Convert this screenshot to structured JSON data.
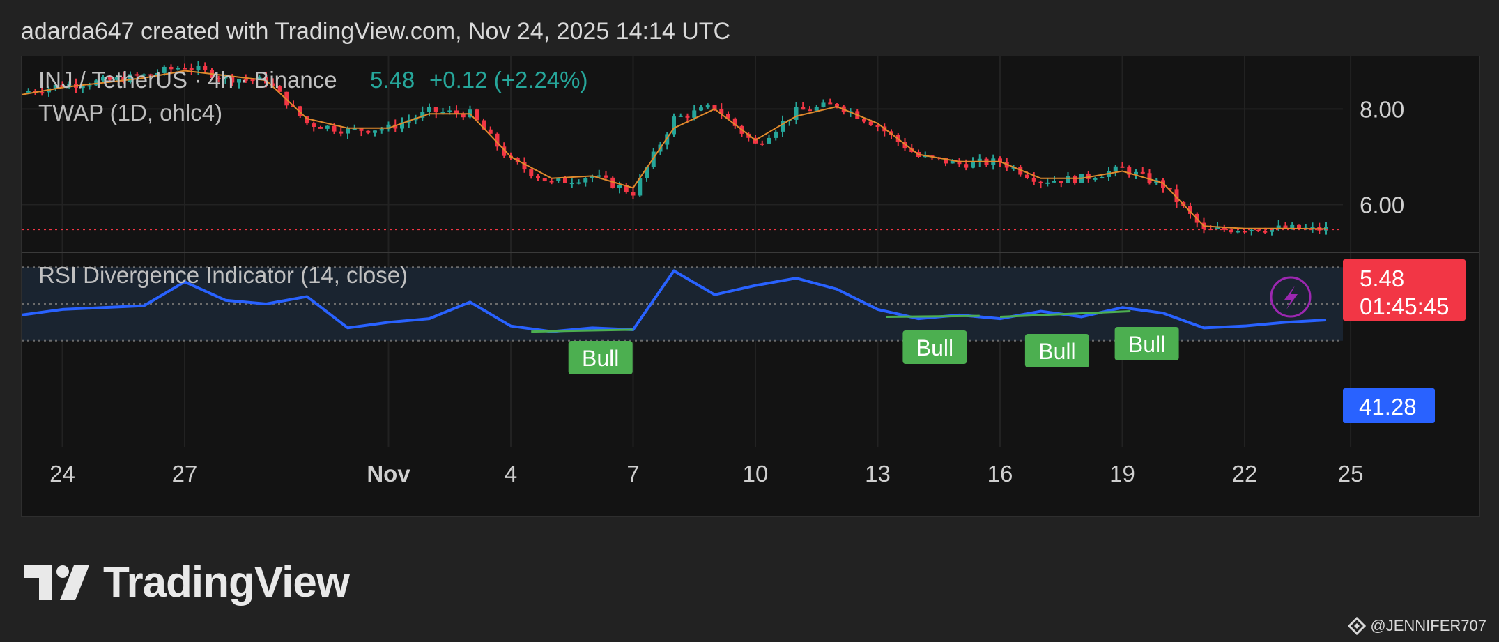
{
  "header": {
    "credit": "adarda647 created with TradingView.com, Nov 24, 2025 14:14 UTC"
  },
  "legend": {
    "symbol": "INJ / TetherUS · 4h · Binance",
    "last": "5.48",
    "change": "+0.12 (+2.24%)",
    "indicator": "TWAP (1D, ohlc4)"
  },
  "rsi_panel": {
    "title": "RSI Divergence Indicator (14, close)",
    "value_label": "41.28"
  },
  "price_scale": {
    "ticks": [
      "8.00",
      "6.00"
    ],
    "last_price": "5.48",
    "countdown": "01:45:45"
  },
  "time_axis": [
    "24",
    "27",
    "Nov",
    "4",
    "7",
    "10",
    "13",
    "16",
    "19",
    "22",
    "25"
  ],
  "bull_labels": [
    "Bull",
    "Bull",
    "Bull",
    "Bull"
  ],
  "brand": {
    "name": "TradingView"
  },
  "watermark": {
    "handle": "@JENNIFER707"
  },
  "colors": {
    "up": "#26a69a",
    "down": "#f23645",
    "twap": "#e08a2c",
    "rsi": "#2962ff",
    "bull": "#4caf50",
    "background": "#131313",
    "lightning": "#9c27b0"
  },
  "chart_data": [
    {
      "type": "line",
      "title": "INJ / TetherUS · 4h · Binance",
      "description": "candlestick price series (4h candles)",
      "x": [
        "Oct 23",
        "Oct 24",
        "Oct 25",
        "Oct 26",
        "Oct 27",
        "Oct 28",
        "Oct 29",
        "Oct 30",
        "Oct 31",
        "Nov 1",
        "Nov 2",
        "Nov 3",
        "Nov 4",
        "Nov 5",
        "Nov 6",
        "Nov 7",
        "Nov 8",
        "Nov 9",
        "Nov 10",
        "Nov 11",
        "Nov 12",
        "Nov 13",
        "Nov 14",
        "Nov 15",
        "Nov 16",
        "Nov 17",
        "Nov 18",
        "Nov 19",
        "Nov 20",
        "Nov 21",
        "Nov 22",
        "Nov 23",
        "Nov 24"
      ],
      "series": [
        {
          "name": "INJ / TetherUS",
          "values": [
            8.35,
            8.5,
            8.58,
            8.7,
            8.9,
            8.65,
            8.6,
            7.7,
            7.55,
            7.6,
            7.95,
            7.9,
            6.9,
            6.45,
            6.6,
            6.25,
            7.8,
            8.05,
            7.25,
            7.95,
            8.1,
            7.65,
            7.0,
            6.85,
            6.9,
            6.5,
            6.55,
            6.75,
            6.4,
            5.45,
            5.5,
            5.5,
            5.48
          ]
        },
        {
          "name": "TWAP (1D, ohlc4)",
          "values": [
            8.3,
            8.45,
            8.55,
            8.65,
            8.8,
            8.7,
            8.6,
            7.8,
            7.6,
            7.6,
            7.9,
            7.9,
            7.0,
            6.55,
            6.6,
            6.35,
            7.6,
            8.0,
            7.35,
            7.85,
            8.05,
            7.7,
            7.05,
            6.9,
            6.9,
            6.55,
            6.55,
            6.7,
            6.45,
            5.55,
            5.5,
            5.5,
            5.49
          ]
        }
      ],
      "ylim": [
        5.0,
        9.1
      ],
      "ticks": [
        "8.00",
        "6.00"
      ],
      "last_price": 5.48,
      "grid": true
    },
    {
      "type": "line",
      "title": "RSI Divergence Indicator (14, close)",
      "x": [
        "Oct 23",
        "Oct 24",
        "Oct 25",
        "Oct 26",
        "Oct 27",
        "Oct 28",
        "Oct 29",
        "Oct 30",
        "Oct 31",
        "Nov 1",
        "Nov 2",
        "Nov 3",
        "Nov 4",
        "Nov 5",
        "Nov 6",
        "Nov 7",
        "Nov 8",
        "Nov 9",
        "Nov 10",
        "Nov 11",
        "Nov 12",
        "Nov 13",
        "Nov 14",
        "Nov 15",
        "Nov 16",
        "Nov 17",
        "Nov 18",
        "Nov 19",
        "Nov 20",
        "Nov 21",
        "Nov 22",
        "Nov 23",
        "Nov 24"
      ],
      "series": [
        {
          "name": "RSI",
          "values": [
            44,
            47,
            48,
            49,
            62,
            52,
            50,
            54,
            37,
            40,
            42,
            51,
            38,
            35,
            37,
            36,
            68,
            55,
            60,
            64,
            58,
            47,
            42,
            44,
            42,
            46,
            43,
            48,
            45,
            37,
            38,
            40,
            41.28
          ]
        }
      ],
      "ylim": [
        25,
        75
      ],
      "bands": [
        30,
        50,
        70
      ],
      "annotations": [
        "Bull",
        "Bull",
        "Bull",
        "Bull"
      ]
    }
  ]
}
